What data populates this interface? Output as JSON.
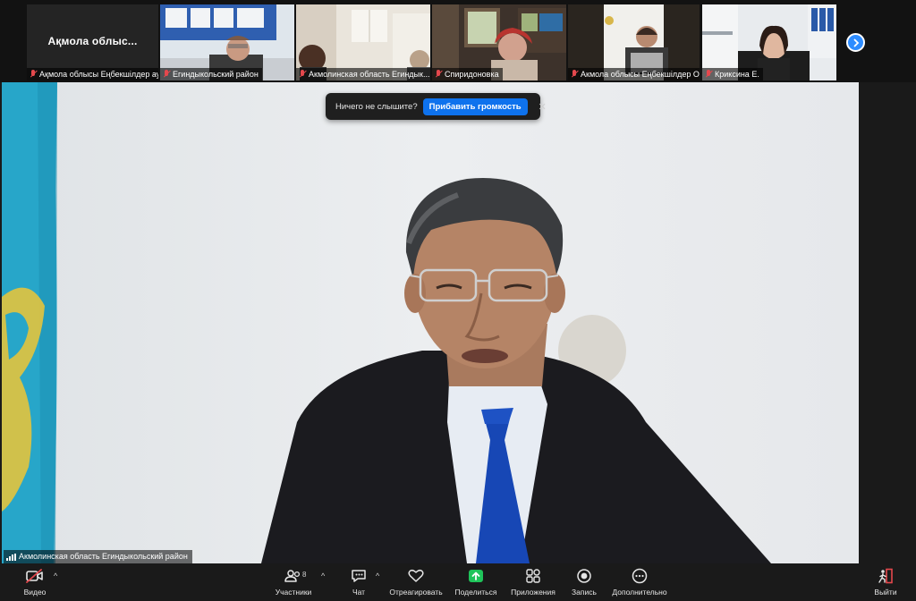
{
  "thumbnails": [
    {
      "label": "Ақмола облысы Еңбекшілдер ауда...",
      "display_name": "Ақмола облыс..."
    },
    {
      "label": "Егиндыкольский район"
    },
    {
      "label": "Акмолинская область  Егиндык..."
    },
    {
      "label": "Спиридоновка"
    },
    {
      "label": "Акмола облысы Еңбекшілдер О..."
    },
    {
      "label": "Криксина Е."
    }
  ],
  "banner": {
    "message": "Ничего не слышите?",
    "action": "Прибавить громкость"
  },
  "main_video": {
    "speaker_label": "Акмолинская область Егиндыкольский район"
  },
  "toolbar": {
    "video": "Видео",
    "participants": "Участники",
    "participants_count": "8",
    "chat": "Чат",
    "react": "Отреагировать",
    "share": "Поделиться",
    "apps": "Приложения",
    "record": "Запись",
    "more": "Дополнительно",
    "leave": "Выйти"
  },
  "colors": {
    "accent": "#0e72ed",
    "share_green": "#1fc45a",
    "mute_red": "#e5484d",
    "leave_red": "#e5484d"
  }
}
